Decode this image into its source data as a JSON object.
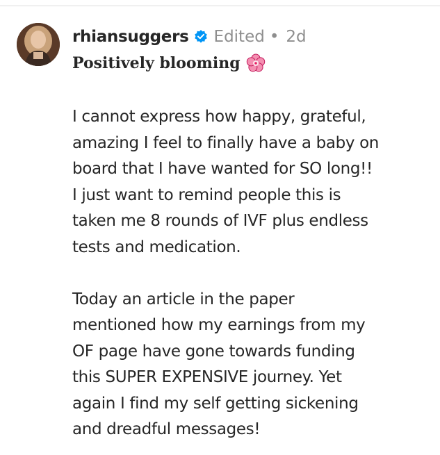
{
  "post": {
    "username": "rhiansuggers",
    "edited_label": "Edited",
    "separator": "•",
    "time": "2d",
    "title": "Positively blooming",
    "title_emoji": "cherry-blossom-icon",
    "caption_lines": [
      "I cannot express how happy, grateful,",
      "amazing I feel to finally have a baby on",
      "board that I have wanted for SO long!!",
      "I just want to remind people this is",
      "taken me 8 rounds of IVF plus endless",
      "tests and medication.",
      "",
      "Today an article in the paper",
      "mentioned how my earnings from my",
      "OF page have gone towards funding",
      "this SUPER EXPENSIVE journey. Yet",
      "again I find my self getting sickening",
      "and dreadful messages!"
    ]
  },
  "colors": {
    "text": "#262626",
    "muted": "#8e8e8e",
    "verified_blue": "#0095f6",
    "flower_pink": "#f48fb1"
  }
}
